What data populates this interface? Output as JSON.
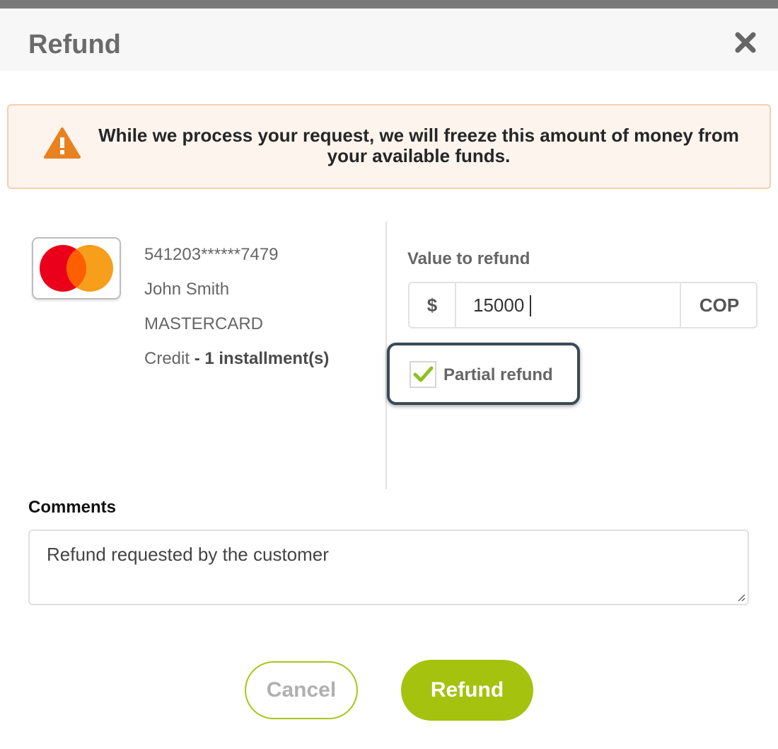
{
  "dialog": {
    "title": "Refund",
    "close_icon": "close-icon"
  },
  "alert": {
    "icon": "warning-triangle-icon",
    "text": "While we process your request, we will freeze this amount of money from your available funds.",
    "color": "#e8821e"
  },
  "card": {
    "brand_icon": "mastercard-logo",
    "number": "541203******7479",
    "holder": "John Smith",
    "brand": "MASTERCARD",
    "type": "Credit",
    "installments_separator": " - ",
    "installments": "1 installment(s)"
  },
  "refund": {
    "value_label": "Value to refund",
    "currency_symbol": "$",
    "amount": "15000",
    "currency_code": "COP",
    "partial_label": "Partial refund",
    "partial_checked": true,
    "check_color": "#8dc21f"
  },
  "comments": {
    "label": "Comments",
    "value": "Refund requested by the customer"
  },
  "actions": {
    "cancel_label": "Cancel",
    "submit_label": "Refund",
    "accent_color": "#a5c20f"
  }
}
